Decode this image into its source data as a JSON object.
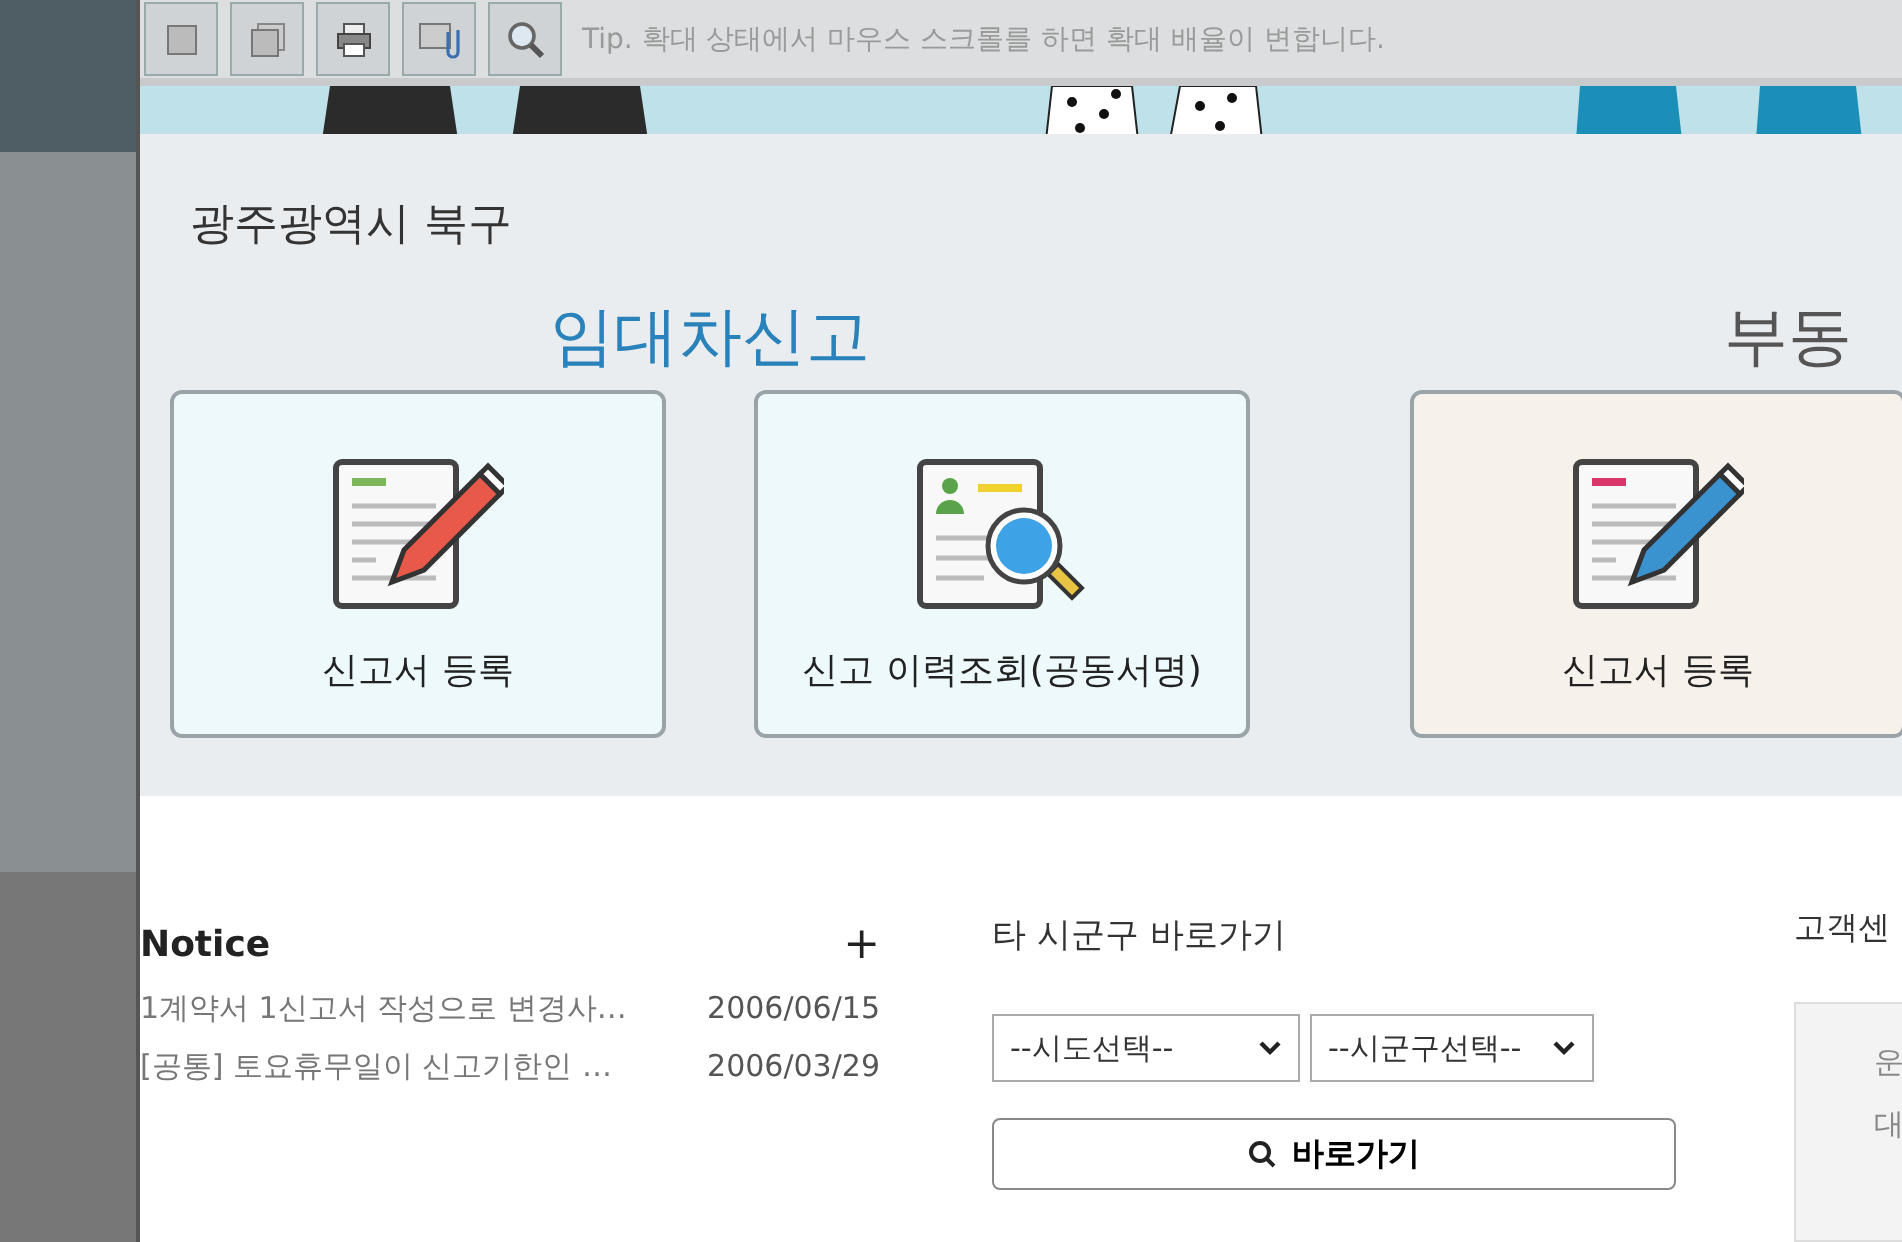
{
  "toolbar": {
    "tip": "Tip. 확대 상태에서 마우스 스크롤를 하면 확대 배율이 변합니다."
  },
  "region_title": "광주광역시 북구",
  "sections": [
    {
      "title": "임대차신고",
      "kind": "lease",
      "cards": [
        {
          "label": "신고서 등록",
          "kind": "register"
        },
        {
          "label": "신고 이력조회(공동서명)",
          "kind": "history"
        }
      ]
    },
    {
      "title": "부동",
      "kind": "realestate",
      "cards": [
        {
          "label": "신고서 등록",
          "kind": "register"
        }
      ]
    }
  ],
  "notice": {
    "title": "Notice",
    "more": "+",
    "items": [
      {
        "title": "1계약서 1신고서 작성으로 변경사…",
        "date": "2006/06/15"
      },
      {
        "title": "[공통] 토요휴무일이 신고기한인 …",
        "date": "2006/03/29"
      }
    ]
  },
  "shortcut": {
    "title": "타 시군구 바로가기",
    "selects": [
      {
        "value": "--시도선택--"
      },
      {
        "value": "--시군구선택--"
      }
    ],
    "button": "바로가기"
  },
  "customer": {
    "title": "고객센",
    "lines": [
      "운",
      "대"
    ]
  }
}
